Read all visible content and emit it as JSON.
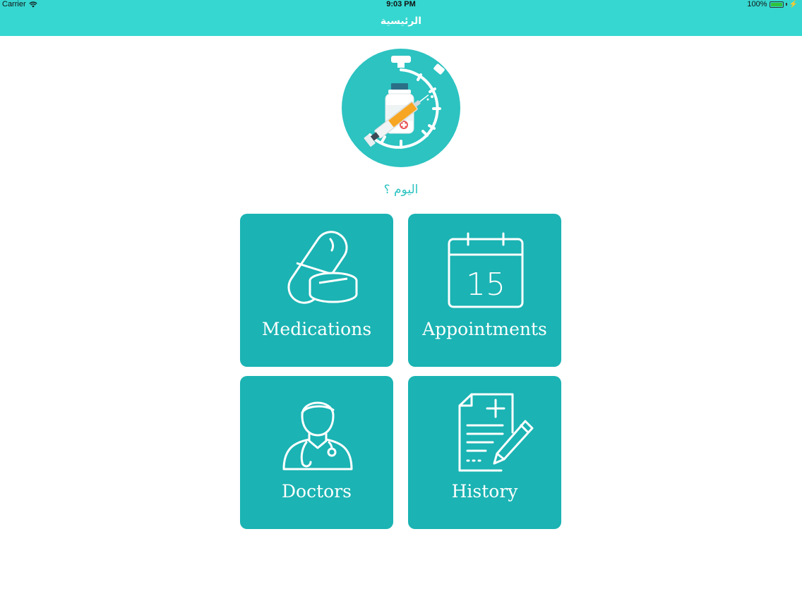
{
  "status_bar": {
    "carrier": "Carrier",
    "time": "9:03 PM",
    "battery": "100%",
    "battery_level": 1.0
  },
  "nav": {
    "title": "الرئيسية"
  },
  "colors": {
    "nav_bg": "#36d7d0",
    "tile_bg": "#1bb3b3",
    "accent_text": "#2cc3c1"
  },
  "header": {
    "logo_icon": "vaccine-timer-icon",
    "question": "اليوم ؟"
  },
  "tiles": [
    {
      "label": "Medications",
      "icon": "pills-icon"
    },
    {
      "label": "Appointments",
      "icon": "calendar-icon",
      "calendar_day": "15"
    },
    {
      "label": "Doctors",
      "icon": "doctor-icon"
    },
    {
      "label": "History",
      "icon": "medical-record-icon"
    }
  ]
}
